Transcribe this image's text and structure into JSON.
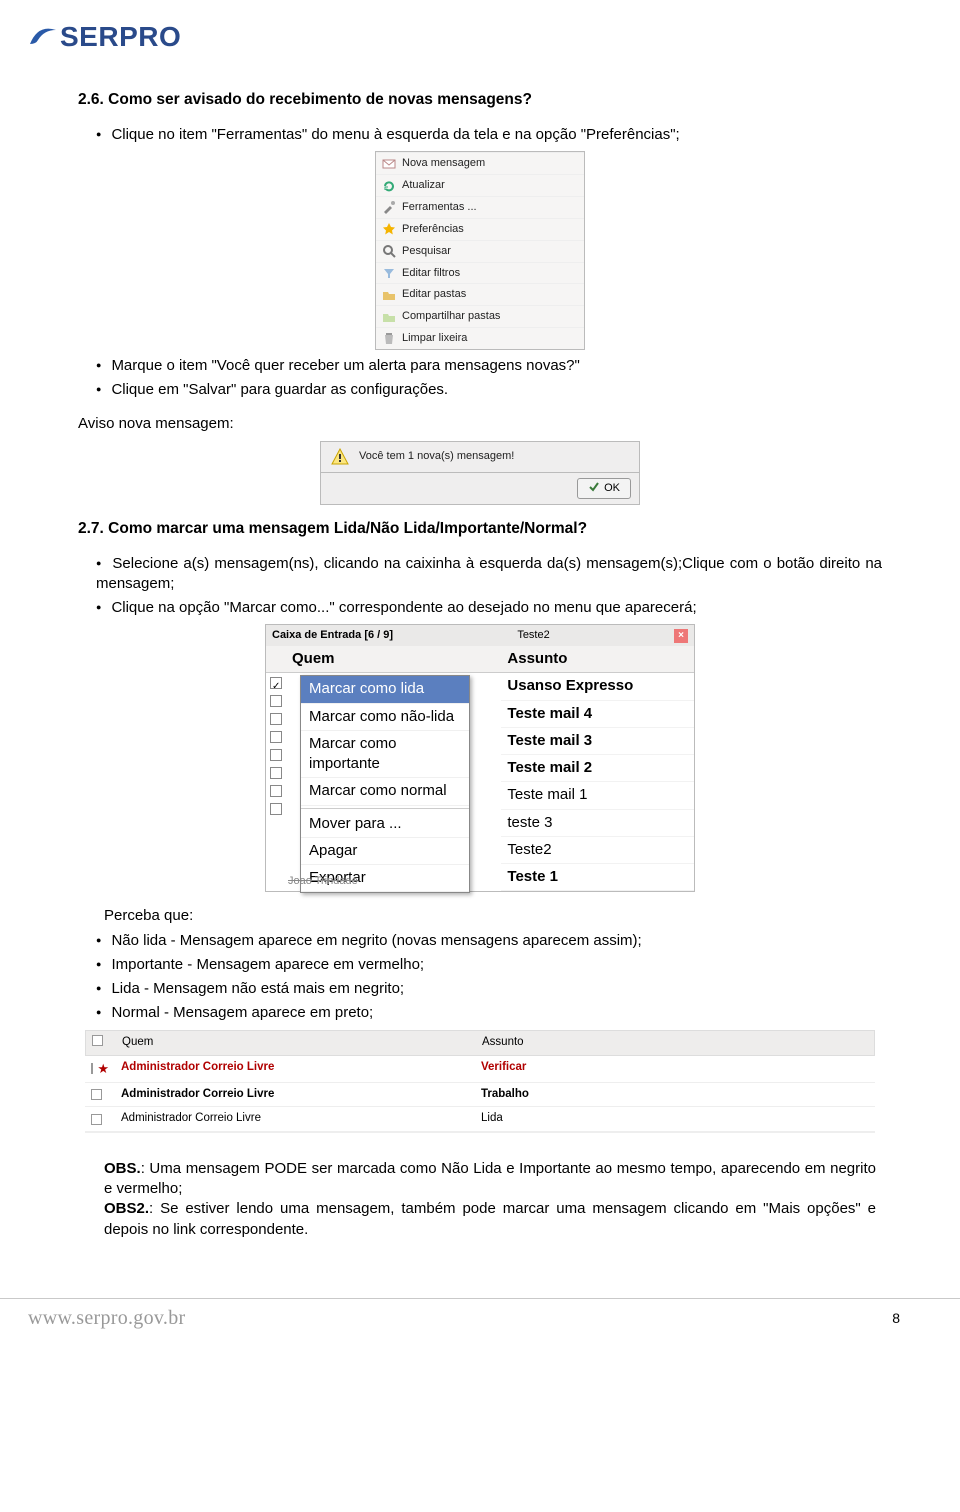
{
  "logo_text": "SERPRO",
  "section_2_6": {
    "title": "2.6. Como ser avisado do recebimento de novas mensagens?",
    "bullet1": "Clique no item \"Ferramentas\" do menu à esquerda da tela e na opção \"Preferências\";",
    "fig_menu": {
      "items": [
        "Nova mensagem",
        "Atualizar",
        "Ferramentas ...",
        "Preferências",
        "Pesquisar",
        "Editar filtros",
        "Editar pastas",
        "Compartilhar pastas",
        "Limpar lixeira"
      ]
    },
    "bullet2": "Marque o item \"Você quer receber um alerta para mensagens novas?\"",
    "bullet3": "Clique em \"Salvar\" para guardar as configurações.",
    "aviso_label": "Aviso nova mensagem:",
    "alert_text": "Você tem 1 nova(s) mensagem!",
    "ok_label": "OK"
  },
  "section_2_7": {
    "title": "2.7. Como marcar uma mensagem Lida/Não Lida/Importante/Normal?",
    "bullet1": "Selecione a(s) mensagem(ns), clicando na caixinha à esquerda da(s) mensagem(s);Clique com o botão direito na mensagem;",
    "bullet2": "Clique na opção \"Marcar como...\" correspondente ao desejado no menu que aparecerá;",
    "ctx": {
      "title": "Caixa de Entrada [6 / 9]",
      "subject_closed": "Teste2",
      "col_quem": "Quem",
      "col_assunto": "Assunto",
      "menu": [
        "Marcar como lida",
        "Marcar como não-lida",
        "Marcar como importante",
        "Marcar como normal",
        "Mover para ...",
        "Apagar",
        "Exportar"
      ],
      "last_sender": "Joao Trindade",
      "subjects": [
        "Usanso Expresso",
        "Teste mail 4",
        "Teste mail 3",
        "Teste mail 2",
        "Teste mail 1",
        "teste 3",
        "Teste2",
        "Teste 1"
      ]
    },
    "perceba": "Perceba que:",
    "pbul1": "Não lida - Mensagem aparece em negrito (novas mensagens aparecem assim);",
    "pbul2": "Importante - Mensagem aparece em vermelho;",
    "pbul3": "Lida - Mensagem não está mais em negrito;",
    "pbul4": "Normal - Mensagem aparece em preto;",
    "table": {
      "col_quem": "Quem",
      "col_assunto": "Assunto",
      "rows": [
        {
          "quem": "Administrador Correio Livre",
          "assunto": "Verificar",
          "unread": true,
          "important": true,
          "star": true
        },
        {
          "quem": "Administrador Correio Livre",
          "assunto": "Trabalho",
          "unread": true,
          "important": false,
          "star": false
        },
        {
          "quem": "Administrador Correio Livre",
          "assunto": "Lida",
          "unread": false,
          "important": false,
          "star": false
        }
      ]
    },
    "obs1_label": "OBS.",
    "obs1_text": ": Uma mensagem PODE ser marcada como Não Lida e Importante ao mesmo tempo, aparecendo em negrito e vermelho;",
    "obs2_label": "OBS2.",
    "obs2_text": ": Se estiver lendo uma mensagem, também pode marcar uma mensagem clicando em \"Mais opções\" e depois no link correspondente."
  },
  "footer": {
    "url": "www.serpro.gov.br",
    "page": "8"
  }
}
